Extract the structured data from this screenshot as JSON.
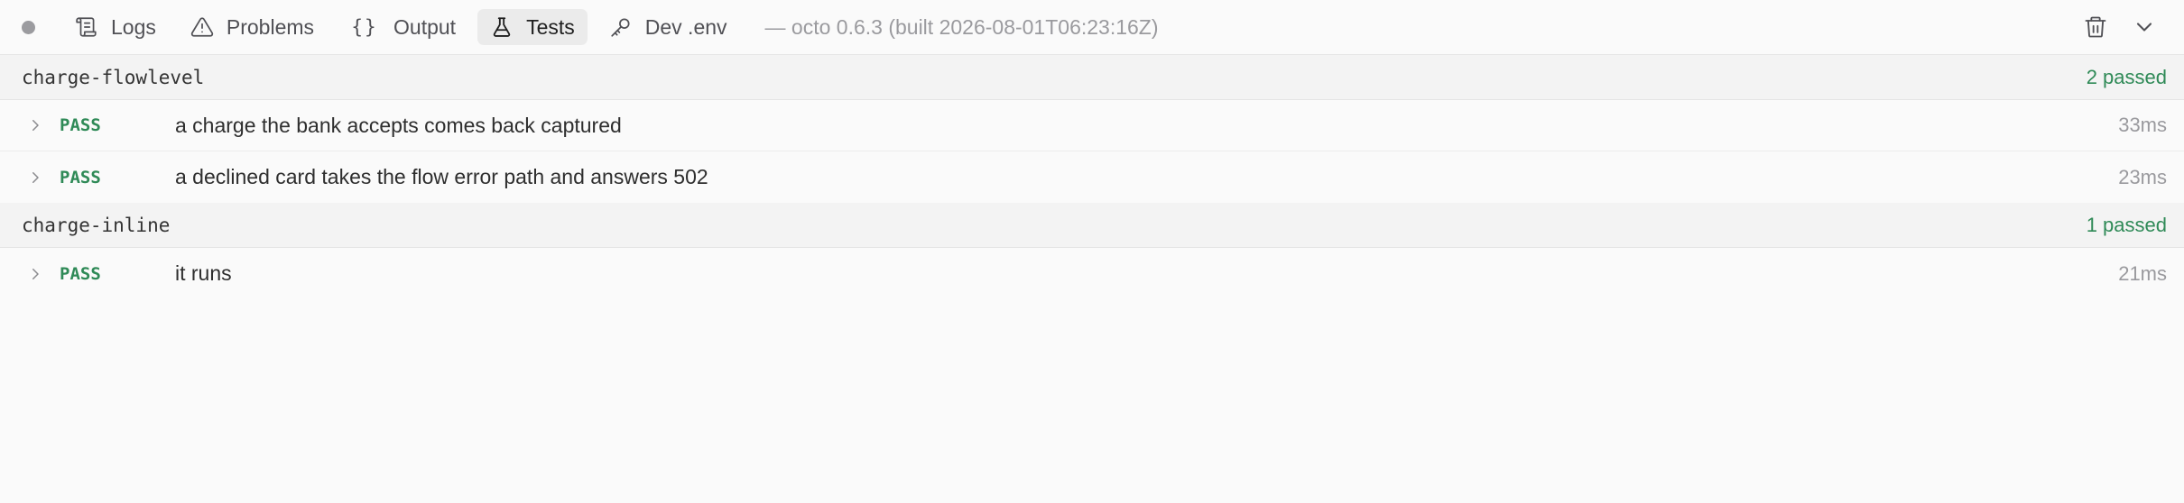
{
  "topbar": {
    "tabs": [
      {
        "label": "Logs",
        "icon": "scroll-icon",
        "active": false
      },
      {
        "label": "Problems",
        "icon": "warning-triangle-icon",
        "active": false
      },
      {
        "label": "Output",
        "icon": "braces-icon",
        "active": false
      },
      {
        "label": "Tests",
        "icon": "flask-icon",
        "active": true
      },
      {
        "label": "Dev .env",
        "icon": "key-icon",
        "active": false
      }
    ],
    "build_info": "— octo 0.6.3 (built 2026-08-01T06:23:16Z)",
    "status_dot_color": "#9b9b9f"
  },
  "suites": [
    {
      "name": "charge-flowlevel",
      "summary": "2 passed",
      "tests": [
        {
          "status": "PASS",
          "name": "a charge the bank accepts comes back captured",
          "duration": "33ms"
        },
        {
          "status": "PASS",
          "name": "a declined card takes the flow error path and answers 502",
          "duration": "23ms"
        }
      ]
    },
    {
      "name": "charge-inline",
      "summary": "1 passed",
      "tests": [
        {
          "status": "PASS",
          "name": "it runs",
          "duration": "21ms"
        }
      ]
    }
  ],
  "colors": {
    "pass": "#2f8a57",
    "muted": "#9a9a9e",
    "active_tab_bg": "#ebebeb"
  }
}
